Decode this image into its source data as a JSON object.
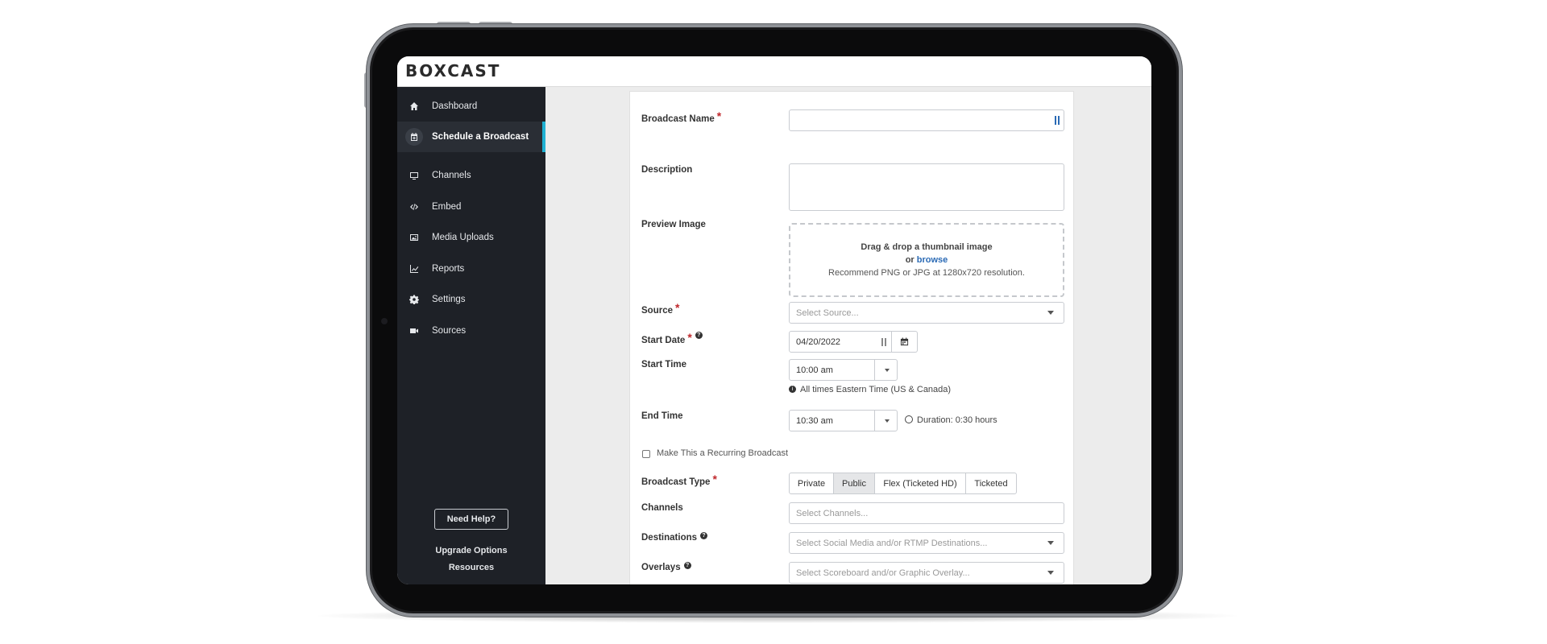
{
  "app": {
    "logo": "BOXCAST"
  },
  "sidebar": {
    "items": [
      {
        "label": "Dashboard",
        "icon": "home-icon"
      },
      {
        "label": "Schedule a Broadcast",
        "icon": "calendar-plus-icon",
        "active": true
      },
      {
        "label": "Channels",
        "icon": "monitor-icon"
      },
      {
        "label": "Embed",
        "icon": "code-icon"
      },
      {
        "label": "Media Uploads",
        "icon": "image-icon"
      },
      {
        "label": "Reports",
        "icon": "chart-line-icon"
      },
      {
        "label": "Settings",
        "icon": "gear-icon"
      },
      {
        "label": "Sources",
        "icon": "video-camera-icon"
      }
    ],
    "help_button": "Need Help?",
    "upgrade_link": "Upgrade Options",
    "resources_link": "Resources",
    "active_color": "#1fb1d3"
  },
  "form": {
    "broadcast_name": {
      "label": "Broadcast Name",
      "required": "*",
      "value": ""
    },
    "description": {
      "label": "Description",
      "value": ""
    },
    "preview_image": {
      "label": "Preview Image",
      "line1": "Drag & drop a thumbnail image",
      "or_text": "or",
      "browse": "browse",
      "hint": "Recommend PNG or JPG at 1280x720 resolution."
    },
    "source": {
      "label": "Source",
      "required": "*",
      "placeholder": "Select Source..."
    },
    "start_date": {
      "label": "Start Date",
      "required": "*",
      "help": "?",
      "value": "04/20/2022"
    },
    "start_time": {
      "label": "Start Time",
      "value": "10:00 am",
      "tz_note": "All times Eastern Time (US & Canada)"
    },
    "end_time": {
      "label": "End Time",
      "value": "10:30 am",
      "duration": "Duration: 0:30 hours"
    },
    "recurring": {
      "label": "Make This a Recurring Broadcast",
      "checked": false
    },
    "broadcast_type": {
      "label": "Broadcast Type",
      "required": "*",
      "options": [
        "Private",
        "Public",
        "Flex (Ticketed HD)",
        "Ticketed"
      ],
      "selected": "Public"
    },
    "channels": {
      "label": "Channels",
      "placeholder": "Select Channels..."
    },
    "destinations": {
      "label": "Destinations",
      "help": "?",
      "placeholder": "Select Social Media and/or RTMP Destinations..."
    },
    "overlays": {
      "label": "Overlays",
      "help": "?",
      "placeholder": "Select Scoreboard and/or Graphic Overlay..."
    }
  }
}
